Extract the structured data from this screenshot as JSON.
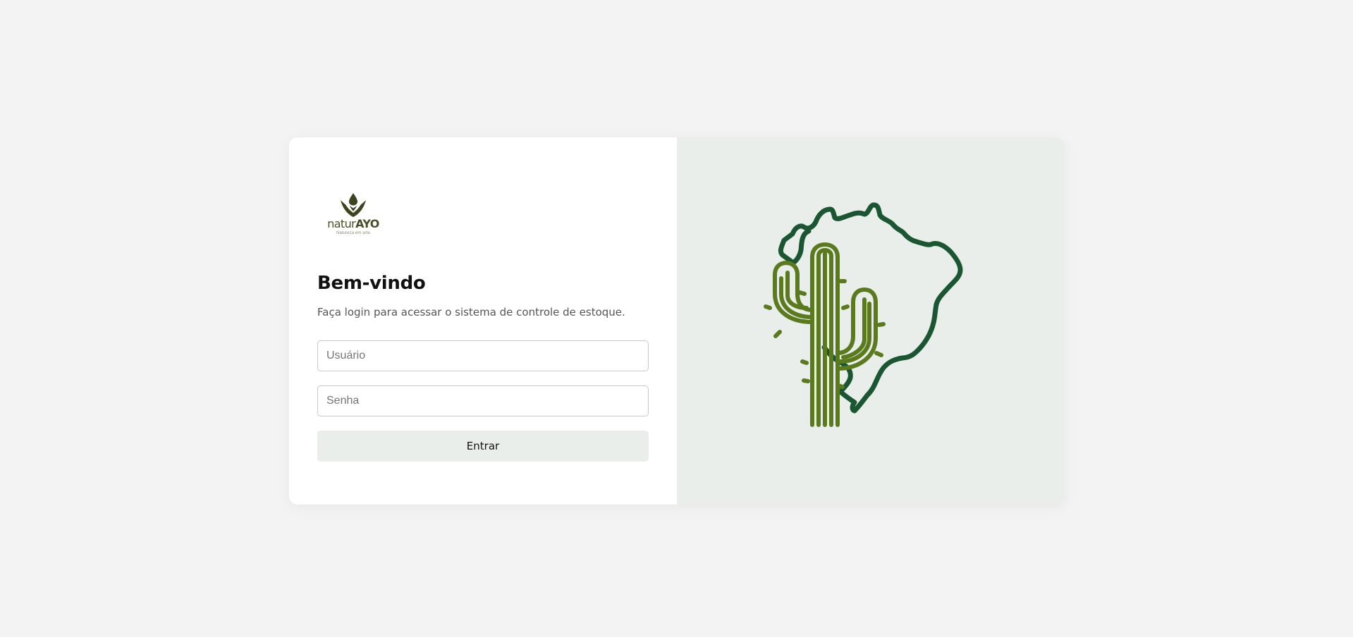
{
  "brand": {
    "name_light": "natur",
    "name_bold": "AYO",
    "tagline": "Natureza em arte"
  },
  "login": {
    "title": "Bem-vindo",
    "subtitle": "Faça login para acessar o sistema de controle de estoque.",
    "username_placeholder": "Usuário",
    "password_placeholder": "Senha",
    "submit_label": "Entrar"
  },
  "illustration": {
    "name": "cactus-brazil-map-icon",
    "map_color": "#1b5632",
    "cactus_color": "#5b7a1e"
  },
  "colors": {
    "page_background": "#f3f3f3",
    "panel_background": "#e9eeea",
    "logo_color": "#3d4420"
  }
}
